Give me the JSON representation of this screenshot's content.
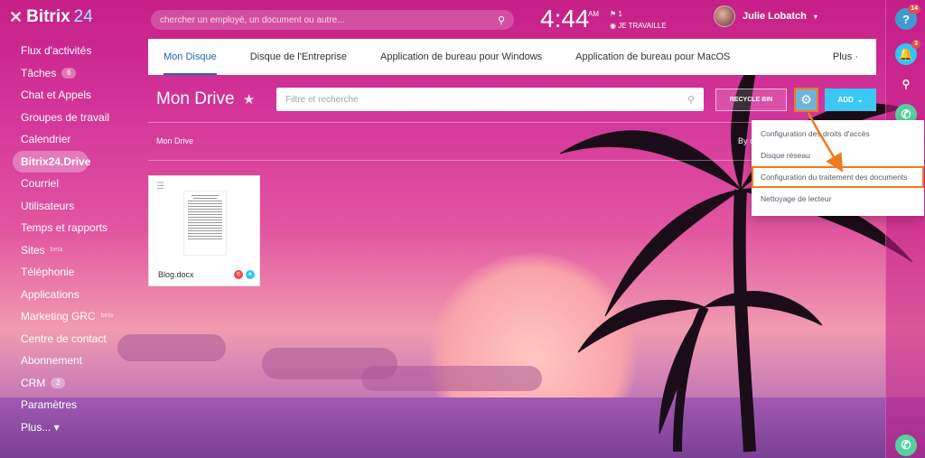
{
  "brand": {
    "name": "Bitrix",
    "suffix": "24"
  },
  "search": {
    "placeholder": "chercher un employé, un document ou autre..."
  },
  "clock": {
    "time": "4:44",
    "ampm": "AM",
    "flags": "1",
    "status": "JE TRAVAILLE"
  },
  "user": {
    "name": "Julie Lobatch"
  },
  "menu": [
    {
      "label": "Flux d'activités"
    },
    {
      "label": "Tâches",
      "count": "6"
    },
    {
      "label": "Chat et Appels"
    },
    {
      "label": "Groupes de travail"
    },
    {
      "label": "Calendrier"
    },
    {
      "label": "Bitrix24.Drive",
      "active": true
    },
    {
      "label": "Courriel"
    },
    {
      "label": "Utilisateurs"
    },
    {
      "label": "Temps et rapports"
    },
    {
      "label": "Sites",
      "beta": "beta"
    },
    {
      "label": "Téléphonie"
    },
    {
      "label": "Applications"
    },
    {
      "label": "Marketing GRC",
      "beta": "beta"
    },
    {
      "label": "Centre de contact"
    },
    {
      "label": "Abonnement"
    },
    {
      "label": "CRM",
      "count": "2"
    },
    {
      "label": "Paramètres"
    },
    {
      "label": "Plus... ▾"
    }
  ],
  "tabs": {
    "t1": "Mon Disque",
    "t2": "Disque de l'Entreprise",
    "t3": "Application de bureau pour Windows",
    "t4": "Application de bureau pour MacOS",
    "more": "Plus ·"
  },
  "page": {
    "title": "Mon Drive",
    "star": "★"
  },
  "filter": {
    "placeholder": "Filtre et recherche"
  },
  "toolbar": {
    "recycle": "RECYCLE BIN",
    "add": "ADD"
  },
  "breadcrumb": "Mon Drive",
  "sort": "By c",
  "file": {
    "name": "Blog.docx"
  },
  "dropdown": {
    "i1": "Configuration des droits d'accès",
    "i2": "Disque réseau",
    "i3": "Configuration du traitement des documents",
    "i4": "Nettoyage de lecteur"
  },
  "rail": {
    "help_badge": "14",
    "notif_badge": "3"
  },
  "colors": {
    "accent": "#2067b0",
    "highlight": "#f07a1e",
    "add": "#3bc8f5"
  }
}
